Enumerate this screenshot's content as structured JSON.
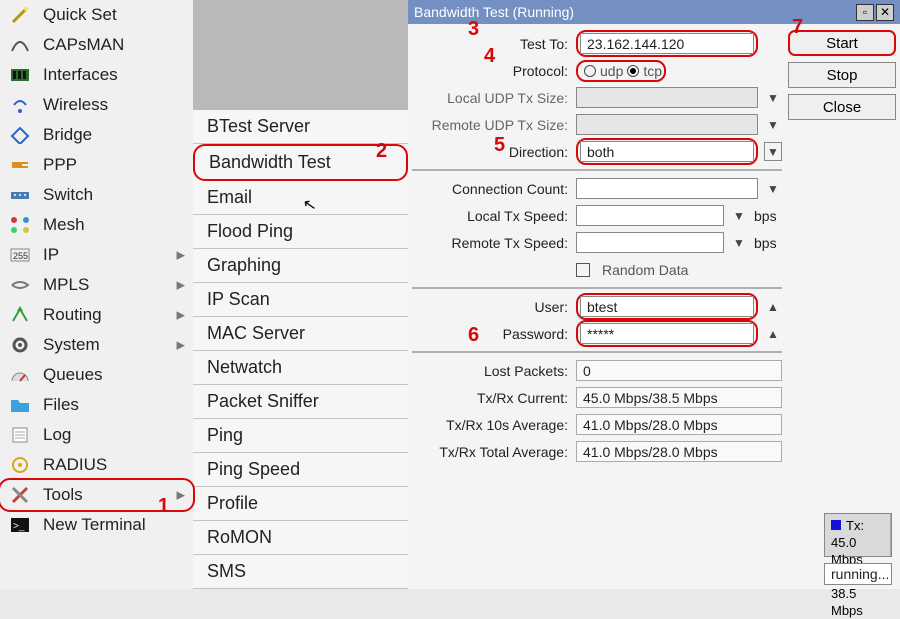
{
  "callouts": {
    "c1": "1",
    "c2": "2",
    "c3": "3",
    "c4": "4",
    "c5": "5",
    "c6": "6",
    "c7": "7"
  },
  "nav": [
    {
      "label": "Quick Set",
      "icon": "wand",
      "sub": false
    },
    {
      "label": "CAPsMAN",
      "icon": "wifi-arc",
      "sub": false
    },
    {
      "label": "Interfaces",
      "icon": "nic",
      "sub": false
    },
    {
      "label": "Wireless",
      "icon": "wifi-dot",
      "sub": false
    },
    {
      "label": "Bridge",
      "icon": "bridge",
      "sub": false
    },
    {
      "label": "PPP",
      "icon": "plug",
      "sub": false
    },
    {
      "label": "Switch",
      "icon": "switch",
      "sub": false
    },
    {
      "label": "Mesh",
      "icon": "mesh",
      "sub": false
    },
    {
      "label": "IP",
      "icon": "ip",
      "sub": true
    },
    {
      "label": "MPLS",
      "icon": "mpls",
      "sub": true
    },
    {
      "label": "Routing",
      "icon": "routing",
      "sub": true
    },
    {
      "label": "System",
      "icon": "gear",
      "sub": true
    },
    {
      "label": "Queues",
      "icon": "gauge",
      "sub": false
    },
    {
      "label": "Files",
      "icon": "folder",
      "sub": false
    },
    {
      "label": "Log",
      "icon": "log",
      "sub": false
    },
    {
      "label": "RADIUS",
      "icon": "radius",
      "sub": false
    },
    {
      "label": "Tools",
      "icon": "tools",
      "sub": true
    },
    {
      "label": "New Terminal",
      "icon": "terminal",
      "sub": false
    }
  ],
  "submenu": [
    "BTest Server",
    "Bandwidth Test",
    "Email",
    "Flood Ping",
    "Graphing",
    "IP Scan",
    "MAC Server",
    "Netwatch",
    "Packet Sniffer",
    "Ping",
    "Ping Speed",
    "Profile",
    "RoMON",
    "SMS"
  ],
  "win": {
    "title": "Bandwidth Test (Running)",
    "buttons": {
      "start": "Start",
      "stop": "Stop",
      "close": "Close"
    },
    "labels": {
      "test_to": "Test To:",
      "protocol": "Protocol:",
      "udp": "udp",
      "tcp": "tcp",
      "local_udp": "Local UDP Tx Size:",
      "remote_udp": "Remote UDP Tx Size:",
      "direction": "Direction:",
      "conn_count": "Connection Count:",
      "local_tx": "Local Tx Speed:",
      "remote_tx": "Remote Tx Speed:",
      "random": "Random Data",
      "user": "User:",
      "password": "Password:",
      "lost": "Lost Packets:",
      "cur": "Tx/Rx Current:",
      "avg10": "Tx/Rx 10s Average:",
      "avgtot": "Tx/Rx Total Average:",
      "bps": "bps"
    },
    "values": {
      "test_to": "23.162.144.120",
      "protocol": "tcp",
      "direction": "both",
      "user": "btest",
      "password": "*****",
      "lost": "0",
      "cur": "45.0 Mbps/38.5 Mbps",
      "avg10": "41.0 Mbps/28.0 Mbps",
      "avgtot": "41.0 Mbps/28.0 Mbps"
    },
    "legend": {
      "tx": "Tx:  45.0 Mbps",
      "rx": "Rx:  38.5 Mbps"
    },
    "status": "running..."
  },
  "chart_data": {
    "type": "area",
    "series": [
      {
        "name": "Tx",
        "color": "#1212d8",
        "value_label": "45.0 Mbps"
      },
      {
        "name": "Rx",
        "color": "#c80606",
        "value_label": "38.5 Mbps"
      }
    ],
    "note": "Miniature live throughput sparkline; majority of plot is empty, rising bars appear at the right edge indicating test just started ramping up.",
    "y_approx_max_mbps": 45
  }
}
